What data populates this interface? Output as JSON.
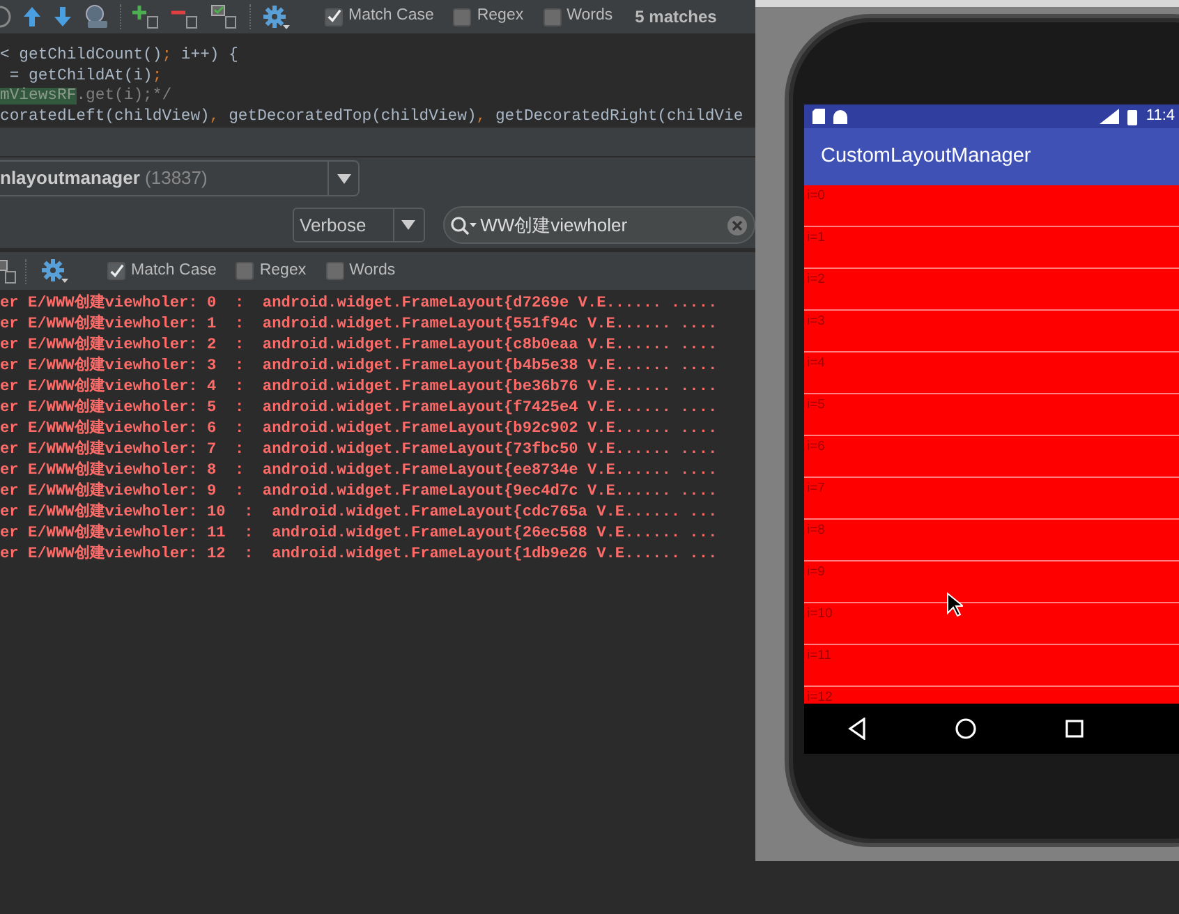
{
  "find_toolbar": {
    "checkboxes": [
      {
        "label": "Match Case",
        "checked": true
      },
      {
        "label": "Regex",
        "checked": false
      },
      {
        "label": "Words",
        "checked": false
      }
    ],
    "matches": "5 matches"
  },
  "code_lines": [
    [
      {
        "text": "< getChildCount()",
        "kind": "plain"
      },
      {
        "text": ";",
        "kind": "punct"
      },
      {
        "text": " i++) {",
        "kind": "plain"
      }
    ],
    [
      {
        "text": " = getChildAt(i)",
        "kind": "plain"
      },
      {
        "text": ";",
        "kind": "punct"
      }
    ],
    [
      {
        "text": "mViewsRF",
        "kind": "match"
      },
      {
        "text": ".get(i);*/",
        "kind": "comment"
      }
    ],
    [
      {
        "text": "coratedLeft(childView)",
        "kind": "plain"
      },
      {
        "text": ", ",
        "kind": "punct"
      },
      {
        "text": "getDecoratedTop(childView)",
        "kind": "plain"
      },
      {
        "text": ", ",
        "kind": "punct"
      },
      {
        "text": "getDecoratedRight(childVie",
        "kind": "plain"
      }
    ]
  ],
  "logcat": {
    "process": {
      "name": "nlayoutmanager",
      "pid": "(13837)"
    },
    "level": "Verbose",
    "search": "WW创建viewholer",
    "find_toolbar": {
      "checkboxes": [
        {
          "label": "Match Case",
          "checked": true
        },
        {
          "label": "Regex",
          "checked": false
        },
        {
          "label": "Words",
          "checked": false
        }
      ]
    },
    "lines": [
      "er E/WWW创建viewholer: 0  :  android.widget.FrameLayout{d7269e V.E...... .....",
      "er E/WWW创建viewholer: 1  :  android.widget.FrameLayout{551f94c V.E...... ....",
      "er E/WWW创建viewholer: 2  :  android.widget.FrameLayout{c8b0eaa V.E...... ....",
      "er E/WWW创建viewholer: 3  :  android.widget.FrameLayout{b4b5e38 V.E...... ....",
      "er E/WWW创建viewholer: 4  :  android.widget.FrameLayout{be36b76 V.E...... ....",
      "er E/WWW创建viewholer: 5  :  android.widget.FrameLayout{f7425e4 V.E...... ....",
      "er E/WWW创建viewholer: 6  :  android.widget.FrameLayout{b92c902 V.E...... ....",
      "er E/WWW创建viewholer: 7  :  android.widget.FrameLayout{73fbc50 V.E...... ....",
      "er E/WWW创建viewholer: 8  :  android.widget.FrameLayout{ee8734e V.E...... ....",
      "er E/WWW创建viewholer: 9  :  android.widget.FrameLayout{9ec4d7c V.E...... ....",
      "er E/WWW创建viewholer: 10  :  android.widget.FrameLayout{cdc765a V.E...... ...",
      "er E/WWW创建viewholer: 11  :  android.widget.FrameLayout{26ec568 V.E...... ...",
      "er E/WWW创建viewholer: 12  :  android.widget.FrameLayout{1db9e26 V.E...... ..."
    ]
  },
  "emulator": {
    "status_time": "11:4",
    "app_title": "CustomLayoutManager",
    "items": [
      "i=0",
      "i=1",
      "i=2",
      "i=3",
      "i=4",
      "i=5",
      "i=6",
      "i=7",
      "i=8",
      "i=9",
      "i=10",
      "i=11",
      "i=12"
    ]
  }
}
